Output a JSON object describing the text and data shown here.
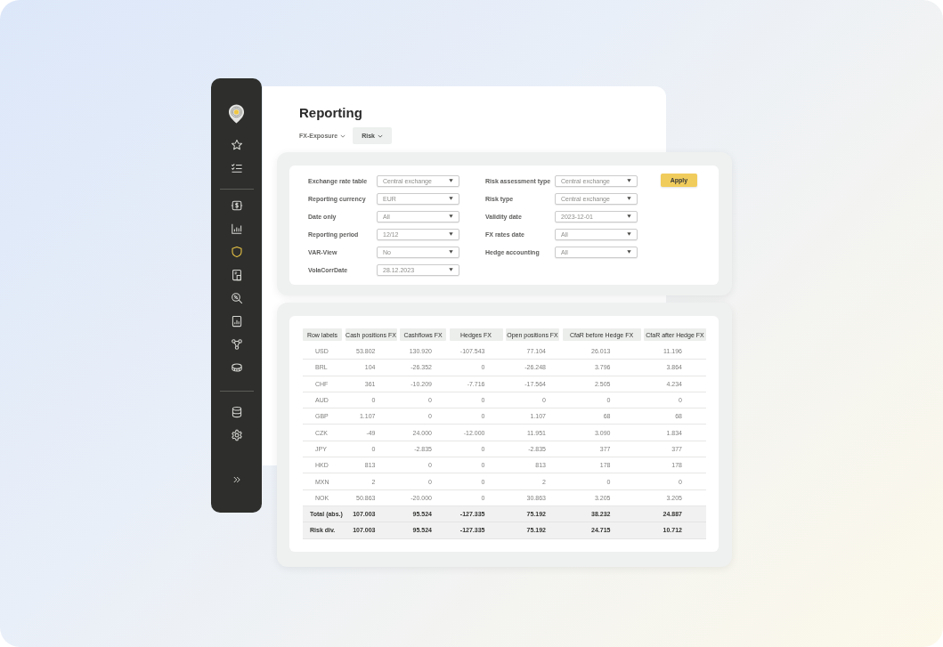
{
  "sidebar": {
    "groups": [
      {
        "items": [
          {
            "selected": false
          },
          {
            "selected": false
          }
        ]
      },
      {
        "items": [
          {
            "selected": false
          },
          {
            "selected": false
          },
          {
            "selected": true
          },
          {
            "selected": false
          },
          {
            "selected": false
          },
          {
            "selected": false
          },
          {
            "selected": false
          },
          {
            "selected": false
          }
        ]
      },
      {
        "items": [
          {
            "selected": false
          },
          {
            "selected": false
          }
        ]
      }
    ]
  },
  "page": {
    "title": "Reporting",
    "tabs": [
      {
        "label": "FX-Exposure",
        "selected": false
      },
      {
        "label": "Risk",
        "selected": true
      }
    ]
  },
  "filters": {
    "columns": [
      {
        "fields": [
          {
            "label": "Exchange rate table",
            "value": "Central exchange"
          },
          {
            "label": "Reporting currency",
            "value": "EUR"
          },
          {
            "label": "Date only",
            "value": "All"
          },
          {
            "label": "Reporting period",
            "value": "12/12"
          },
          {
            "label": "VAR-View",
            "value": "No"
          },
          {
            "label": "VolaCorrDate",
            "value": "28.12.2023"
          }
        ]
      },
      {
        "fields": [
          {
            "label": "Risk assessment type",
            "value": "Central exchange"
          },
          {
            "label": "Risk type",
            "value": "Central exchange"
          },
          {
            "label": "Validity date",
            "value": "2023-12-01"
          },
          {
            "label": "FX rates date",
            "value": "All"
          },
          {
            "label": "Hedge accounting",
            "value": "All"
          }
        ]
      }
    ],
    "apply_button": "Apply"
  },
  "table": {
    "columns": [
      "Row labels",
      "Cash positions FX",
      "Cashflows FX",
      "Hedges FX",
      "Open positions FX",
      "CfaR before Hedge FX",
      "CfaR after Hedge FX"
    ],
    "rows": [
      {
        "kind": "data",
        "cells": [
          "USD",
          "53.802",
          "130.920",
          "-107.543",
          "77.104",
          "26.013",
          "11.196"
        ]
      },
      {
        "kind": "data",
        "cells": [
          "BRL",
          "104",
          "-26.352",
          "0",
          "-26.248",
          "3.796",
          "3.864"
        ]
      },
      {
        "kind": "data",
        "cells": [
          "CHF",
          "361",
          "-10.209",
          "-7.716",
          "-17.564",
          "2.505",
          "4.234"
        ]
      },
      {
        "kind": "data",
        "cells": [
          "AUD",
          "0",
          "0",
          "0",
          "0",
          "0",
          "0"
        ]
      },
      {
        "kind": "data",
        "cells": [
          "GBP",
          "1.107",
          "0",
          "0",
          "1.107",
          "68",
          "68"
        ]
      },
      {
        "kind": "data",
        "cells": [
          "CZK",
          "-49",
          "24.000",
          "-12.000",
          "11.951",
          "3.090",
          "1.834"
        ]
      },
      {
        "kind": "data",
        "cells": [
          "JPY",
          "0",
          "-2.835",
          "0",
          "-2.835",
          "377",
          "377"
        ]
      },
      {
        "kind": "data",
        "cells": [
          "HKD",
          "813",
          "0",
          "0",
          "813",
          "178",
          "178"
        ]
      },
      {
        "kind": "data",
        "cells": [
          "MXN",
          "2",
          "0",
          "0",
          "2",
          "0",
          "0"
        ]
      },
      {
        "kind": "data",
        "cells": [
          "NOK",
          "50.863",
          "-20.000",
          "0",
          "30.863",
          "3.205",
          "3.205"
        ]
      },
      {
        "kind": "total",
        "cells": [
          "Total (abs.)",
          "107.003",
          "95.524",
          "-127.335",
          "75.192",
          "38.232",
          "24.887"
        ]
      },
      {
        "kind": "total",
        "cells": [
          "Risk div.",
          "107.003",
          "95.524",
          "-127.335",
          "75.192",
          "24.715",
          "10.712"
        ]
      }
    ]
  }
}
